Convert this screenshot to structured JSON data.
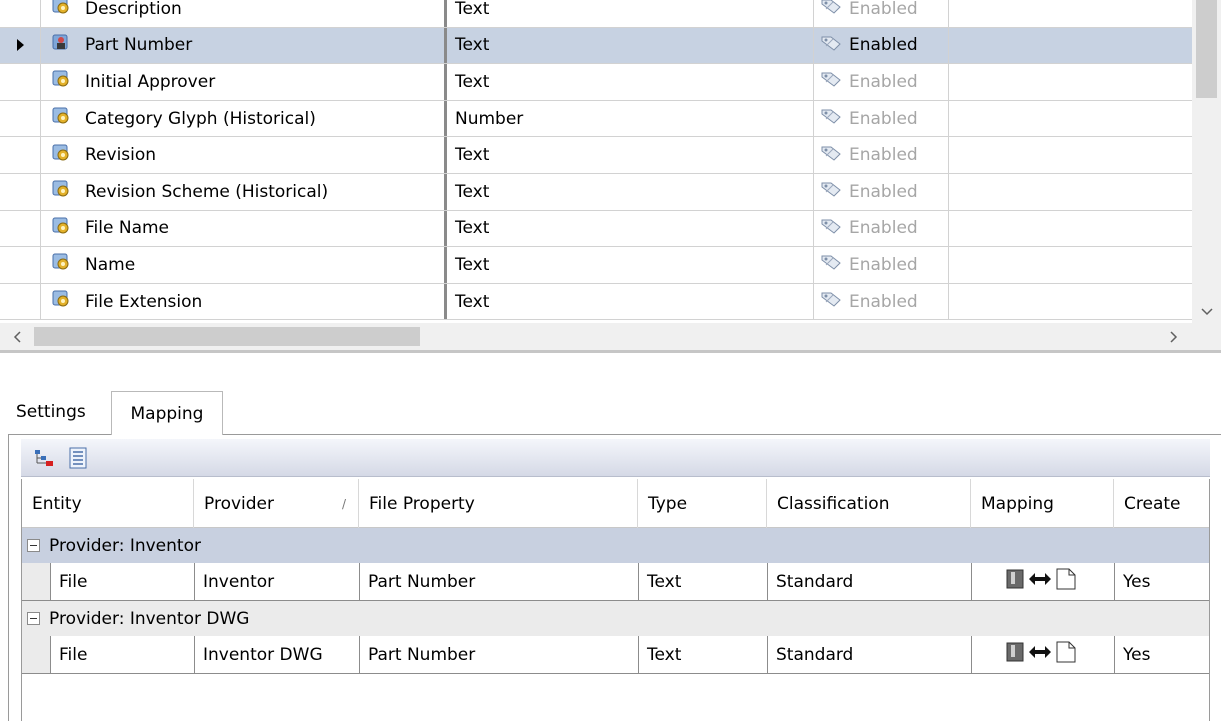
{
  "properties": {
    "rows": [
      {
        "name": "Description",
        "type": "Text",
        "state": "Enabled",
        "selected": false
      },
      {
        "name": "Part Number",
        "type": "Text",
        "state": "Enabled",
        "selected": true
      },
      {
        "name": "Initial Approver",
        "type": "Text",
        "state": "Enabled",
        "selected": false
      },
      {
        "name": "Category Glyph (Historical)",
        "type": "Number",
        "state": "Enabled",
        "selected": false
      },
      {
        "name": "Revision",
        "type": "Text",
        "state": "Enabled",
        "selected": false
      },
      {
        "name": "Revision Scheme (Historical)",
        "type": "Text",
        "state": "Enabled",
        "selected": false
      },
      {
        "name": "File Name",
        "type": "Text",
        "state": "Enabled",
        "selected": false
      },
      {
        "name": "Name",
        "type": "Text",
        "state": "Enabled",
        "selected": false
      },
      {
        "name": "File Extension",
        "type": "Text",
        "state": "Enabled",
        "selected": false
      }
    ]
  },
  "tabs": {
    "settings": "Settings",
    "mapping": "Mapping",
    "active": "mapping"
  },
  "mapping": {
    "headers": {
      "entity": "Entity",
      "provider": "Provider",
      "file_property": "File Property",
      "type": "Type",
      "classification": "Classification",
      "mapping": "Mapping",
      "create": "Create"
    },
    "groups": [
      {
        "label": "Provider: Inventor",
        "row": {
          "entity": "File",
          "provider": "Inventor",
          "file_property": "Part Number",
          "type": "Text",
          "classification": "Standard",
          "mapping_icon": "bidirectional-mapping-icon",
          "create": "Yes"
        }
      },
      {
        "label": "Provider: Inventor DWG",
        "row": {
          "entity": "File",
          "provider": "Inventor DWG",
          "file_property": "Part Number",
          "type": "Text",
          "classification": "Standard",
          "mapping_icon": "bidirectional-mapping-icon",
          "create": "Yes"
        }
      }
    ]
  },
  "colors": {
    "selected_row": "#c7d2e2",
    "group_header_active": "#c8d0e0",
    "disabled_text": "#a6a6a6"
  }
}
